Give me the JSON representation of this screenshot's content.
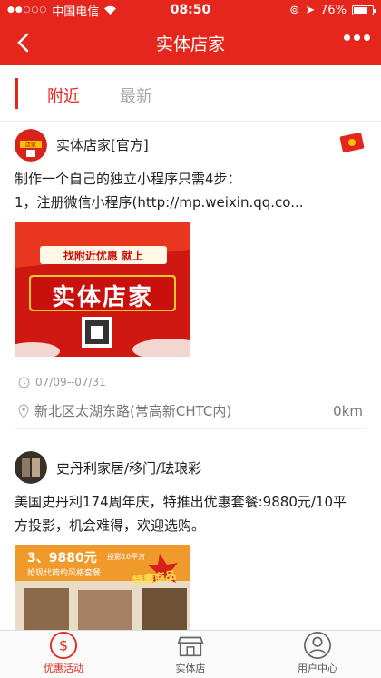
{
  "status": {
    "carrier": "中国电信",
    "time": "08:50",
    "battery": "76%",
    "battery_level": 0.76
  },
  "nav": {
    "title": "实体店家"
  },
  "tabs": {
    "active": "附近",
    "inactive": "最新"
  },
  "store1": {
    "name": "实体店家[官方]",
    "desc_line1": "制作一个自己的独立小程序只需4步：",
    "desc_line2": "1，注册微信小程序(http://mp.weixin.qq.co...",
    "banner_top": "找附近优惠 就上",
    "banner_main": "实体店家",
    "date": "07/09--07/31",
    "address": "新北区太湖东路(常高新CHTC内)",
    "distance": "0km"
  },
  "store2": {
    "name": "史丹利家居/移门/珐琅彩",
    "desc_line1": "美国史丹利174周年庆，特推出优惠套餐:9880元/10平",
    "desc_line2": "方投影，机会难得，欢迎选购。",
    "banner_price": "3、9880元",
    "banner_sub": "投影10平方",
    "banner_line": "抢现代简约风格套餐",
    "banner_badge": "特惠商品"
  },
  "tabbar": {
    "promo": "优惠活动",
    "store": "实体店",
    "user": "用户中心"
  },
  "colors": {
    "brand": "#e5261d"
  }
}
